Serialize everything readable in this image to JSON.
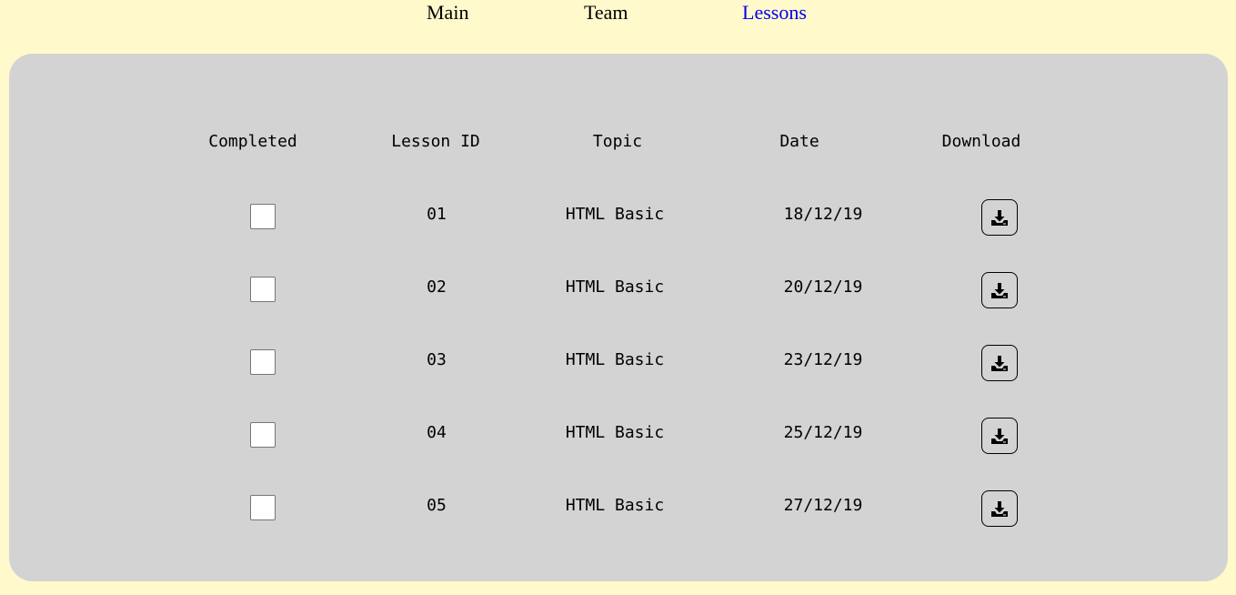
{
  "nav": {
    "main": "Main",
    "team": "Team",
    "lessons": "Lessons"
  },
  "table": {
    "headers": {
      "completed": "Completed",
      "lesson_id": "Lesson ID",
      "topic": "Topic",
      "date": "Date",
      "download": "Download"
    },
    "rows": [
      {
        "id": "01",
        "topic": "HTML Basic",
        "date": "18/12/19",
        "completed": false
      },
      {
        "id": "02",
        "topic": "HTML Basic",
        "date": "20/12/19",
        "completed": false
      },
      {
        "id": "03",
        "topic": "HTML Basic",
        "date": "23/12/19",
        "completed": false
      },
      {
        "id": "04",
        "topic": "HTML Basic",
        "date": "25/12/19",
        "completed": false
      },
      {
        "id": "05",
        "topic": "HTML Basic",
        "date": "27/12/19",
        "completed": false
      }
    ],
    "download_icon": "download-icon"
  },
  "colors": {
    "page_background": "#fff9cc",
    "panel_background": "#d3d3d3",
    "active_link": "#0000ee"
  }
}
